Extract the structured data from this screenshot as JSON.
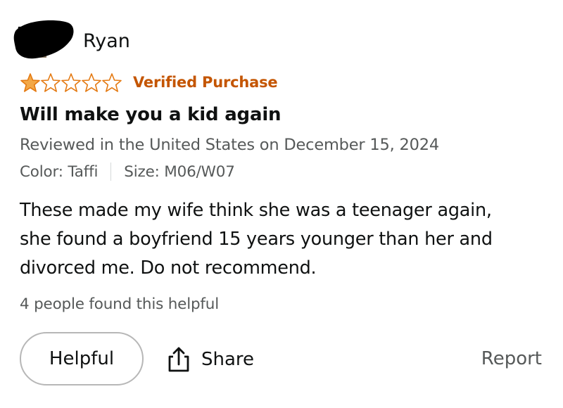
{
  "reviewer": {
    "name": "Ryan"
  },
  "rating": {
    "stars_filled": 1,
    "stars_total": 5,
    "star_color": "#f3a847",
    "star_outline_color": "#e47911"
  },
  "badges": {
    "verified": "Verified Purchase",
    "verified_color": "#c45500"
  },
  "review": {
    "title": "Will make you a kid again",
    "meta": "Reviewed in the United States on December 15, 2024",
    "color": "Color: Taffi",
    "size": "Size: M06/W07",
    "body": "These made my wife think she was a teenager again,\nshe found a boyfriend 15 years younger than her and\ndivorced me. Do not recommend.",
    "helpful_count": "4 people found this helpful"
  },
  "actions": {
    "helpful_label": "Helpful",
    "share_label": "Share",
    "report_label": "Report"
  },
  "icons": {
    "share": "share-icon",
    "avatar": "avatar-redacted",
    "star": "star-icon"
  }
}
